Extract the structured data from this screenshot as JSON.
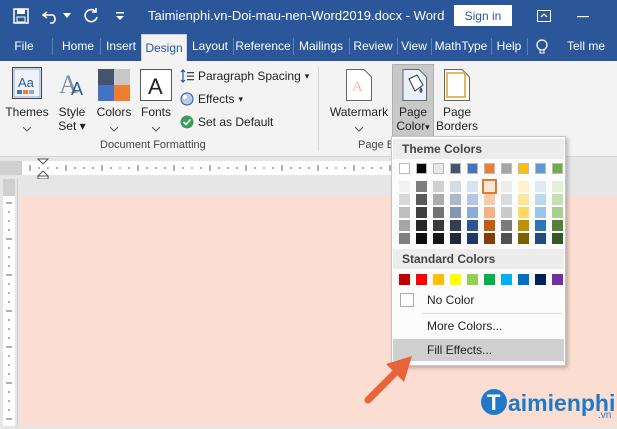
{
  "window": {
    "title": "Taimienphi.vn-Doi-mau-nen-Word2019.docx  -  Word",
    "sign_in": "Sign in"
  },
  "tabs": [
    "File",
    "Home",
    "Insert",
    "Design",
    "Layout",
    "Reference",
    "Mailings",
    "Review",
    "View",
    "MathType",
    "Help",
    "Tell me"
  ],
  "active_tab": "Design",
  "ribbon": {
    "themes": {
      "line1": "Themes",
      "arrow": "⌄"
    },
    "style_set": {
      "line1": "Style",
      "line2": "Set"
    },
    "colors": "Colors",
    "fonts": "Fonts",
    "paragraph_spacing": "Paragraph Spacing",
    "effects": "Effects",
    "set_as_default": "Set as Default",
    "document_formatting": "Document Formatting",
    "watermark": "Watermark",
    "page_color": {
      "line1": "Page",
      "line2": "Color"
    },
    "page_borders": {
      "line1": "Page",
      "line2": "Borders"
    },
    "page_background": "Page B"
  },
  "page_color_menu": {
    "theme_colors_header": "Theme Colors",
    "standard_colors_header": "Standard Colors",
    "no_color": "No Color",
    "more_colors": "More Colors...",
    "fill_effects": "Fill Effects...",
    "theme_top_row": [
      "#ffffff",
      "#000000",
      "#e7e6e6",
      "#44546a",
      "#4472c4",
      "#ed7d31",
      "#a5a5a5",
      "#ffc000",
      "#5b9bd5",
      "#70ad47"
    ],
    "theme_shades": [
      [
        "#f2f2f2",
        "#d8d8d8",
        "#bfbfbf",
        "#a5a5a5",
        "#7f7f7f"
      ],
      [
        "#7f7f7f",
        "#595959",
        "#3f3f3f",
        "#262626",
        "#0d0d0d"
      ],
      [
        "#d0cece",
        "#aeabab",
        "#757171",
        "#3a3838",
        "#171616"
      ],
      [
        "#d6dce4",
        "#adb9ca",
        "#8496b0",
        "#333f4f",
        "#222a35"
      ],
      [
        "#d9e2f3",
        "#b4c7e7",
        "#8eaadb",
        "#2f5496",
        "#1f3864"
      ],
      [
        "#fbe5d5",
        "#f7caac",
        "#f4b183",
        "#c55a11",
        "#843c0b"
      ],
      [
        "#ededed",
        "#dbdbdb",
        "#c9c9c9",
        "#7b7b7b",
        "#525252"
      ],
      [
        "#fff2cc",
        "#ffe599",
        "#ffd966",
        "#bf9000",
        "#7f6000"
      ],
      [
        "#deebf6",
        "#bdd7ee",
        "#9dc3e6",
        "#2e75b5",
        "#1e4e79"
      ],
      [
        "#e2efd9",
        "#c5e0b3",
        "#a8d08d",
        "#538135",
        "#375623"
      ]
    ],
    "standard": [
      "#c00000",
      "#ff0000",
      "#ffc000",
      "#ffff00",
      "#92d050",
      "#00b050",
      "#00b0f0",
      "#0070c0",
      "#002060",
      "#7030a0"
    ]
  },
  "branding": {
    "logo_text": "aimienphi",
    "logo_suffix": ".vn",
    "logo_letter": "T"
  },
  "colors": {
    "accent": "#2b579a",
    "page_background": "#fbded1",
    "arrow": "#e8623a"
  }
}
